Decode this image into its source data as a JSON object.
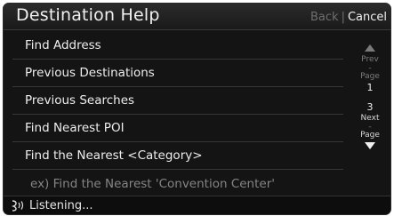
{
  "header": {
    "title": "Destination Help",
    "back_label": "Back",
    "separator": "|",
    "cancel_label": "Cancel"
  },
  "menu": {
    "items": [
      {
        "label": "Find Address"
      },
      {
        "label": "Previous Destinations"
      },
      {
        "label": "Previous Searches"
      },
      {
        "label": "Find Nearest POI"
      },
      {
        "label": "Find the Nearest <Category>"
      }
    ],
    "example": "ex) Find the Nearest 'Convention Center'"
  },
  "pager": {
    "prev_label": "Prev",
    "prev_dash": "-",
    "page_label_top": "Page",
    "current_page": "1",
    "total_pages": "3",
    "next_label": "Next",
    "next_dash": "-",
    "page_label_bottom": "Page",
    "up_icon": "triangle-up",
    "down_icon": "triangle-down"
  },
  "status": {
    "icon": "voice-icon",
    "text": "Listening..."
  },
  "colors": {
    "background": "#141414",
    "text": "#eeeeee",
    "disabled": "#6f6f6f"
  }
}
